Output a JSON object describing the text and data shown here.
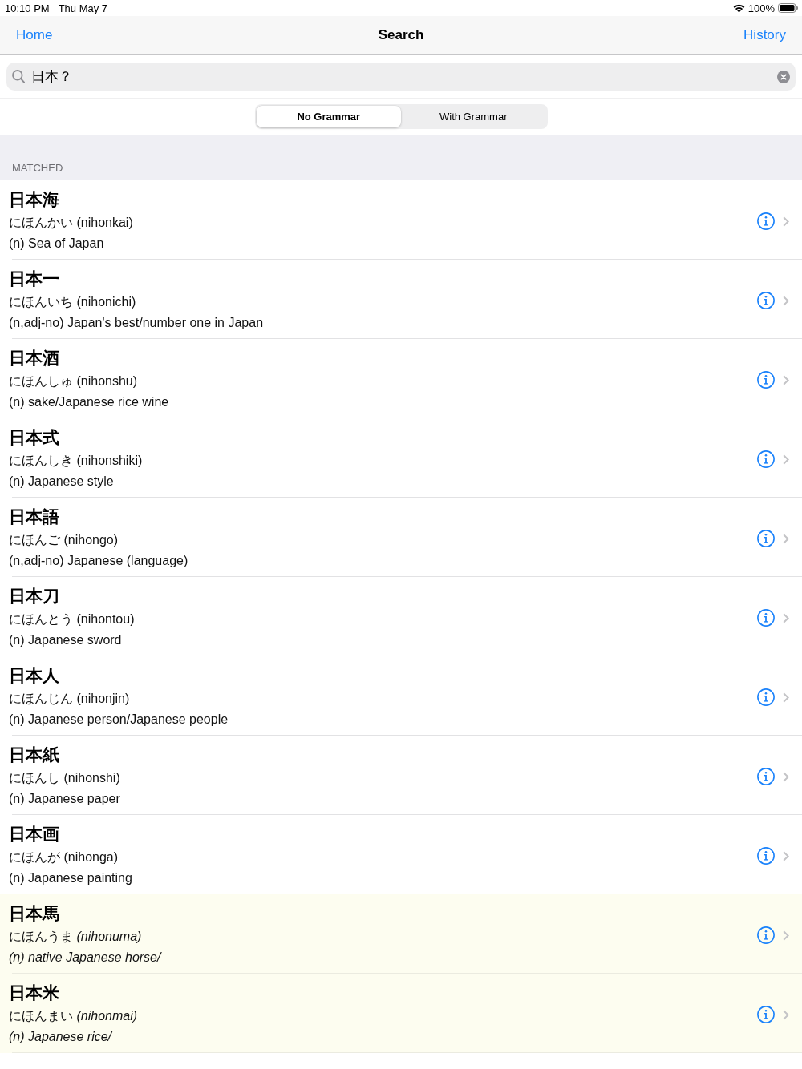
{
  "status_bar": {
    "time": "10:10 PM",
    "date": "Thu May 7",
    "battery": "100%"
  },
  "nav_bar": {
    "left": "Home",
    "title": "Search",
    "right": "History"
  },
  "search": {
    "value": "日本？"
  },
  "segments": [
    {
      "label": "No Grammar",
      "selected": true
    },
    {
      "label": "With Grammar",
      "selected": false
    }
  ],
  "section": {
    "title": "MATCHED"
  },
  "results": [
    {
      "word": "日本海",
      "reading": "にほんかい (nihonkai)",
      "gloss": "(n) Sea of Japan",
      "highlighted": false
    },
    {
      "word": "日本一",
      "reading": "にほんいち (nihonichi)",
      "gloss": "(n,adj-no) Japan's best/number one in Japan",
      "highlighted": false
    },
    {
      "word": "日本酒",
      "reading": "にほんしゅ (nihonshu)",
      "gloss": "(n) sake/Japanese rice wine",
      "highlighted": false
    },
    {
      "word": "日本式",
      "reading": "にほんしき (nihonshiki)",
      "gloss": "(n) Japanese style",
      "highlighted": false
    },
    {
      "word": "日本語",
      "reading": "にほんご (nihongo)",
      "gloss": "(n,adj-no) Japanese (language)",
      "highlighted": false
    },
    {
      "word": "日本刀",
      "reading": "にほんとう (nihontou)",
      "gloss": "(n) Japanese sword",
      "highlighted": false
    },
    {
      "word": "日本人",
      "reading": "にほんじん (nihonjin)",
      "gloss": "(n) Japanese person/Japanese people",
      "highlighted": false
    },
    {
      "word": "日本紙",
      "reading": "にほんし (nihonshi)",
      "gloss": "(n) Japanese paper",
      "highlighted": false
    },
    {
      "word": "日本画",
      "reading": "にほんが (nihonga)",
      "gloss": "(n) Japanese painting",
      "highlighted": false
    },
    {
      "word": "日本馬",
      "reading": "にほんうま *(nihonuma)*",
      "gloss": "(n) native Japanese horse/",
      "highlighted": true
    },
    {
      "word": "日本米",
      "reading": "にほんまい *(nihonmai)*",
      "gloss": "(n) Japanese rice/",
      "highlighted": true
    }
  ]
}
